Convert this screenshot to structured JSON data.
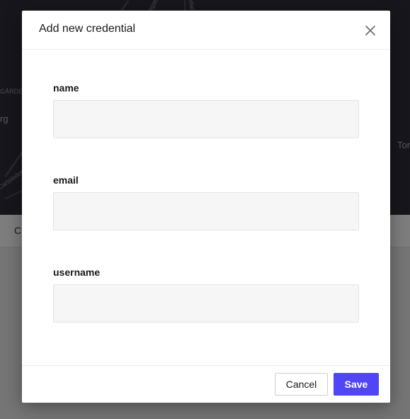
{
  "background": {
    "map_labels": [
      "GÅRDE",
      "rg",
      "Tor",
      "Carlsleden",
      "Pärsgatan",
      "ellaren"
    ],
    "strip_text": "C"
  },
  "modal": {
    "title": "Add new credential",
    "fields": [
      {
        "label": "name",
        "value": "",
        "placeholder": ""
      },
      {
        "label": "email",
        "value": "",
        "placeholder": ""
      },
      {
        "label": "username",
        "value": "",
        "placeholder": ""
      }
    ],
    "cancel_label": "Cancel",
    "save_label": "Save"
  },
  "colors": {
    "accent": "#5046f5",
    "input_bg": "#f6f6f6",
    "overlay_map": "#16161c"
  },
  "icons": {
    "close": "close-icon"
  }
}
